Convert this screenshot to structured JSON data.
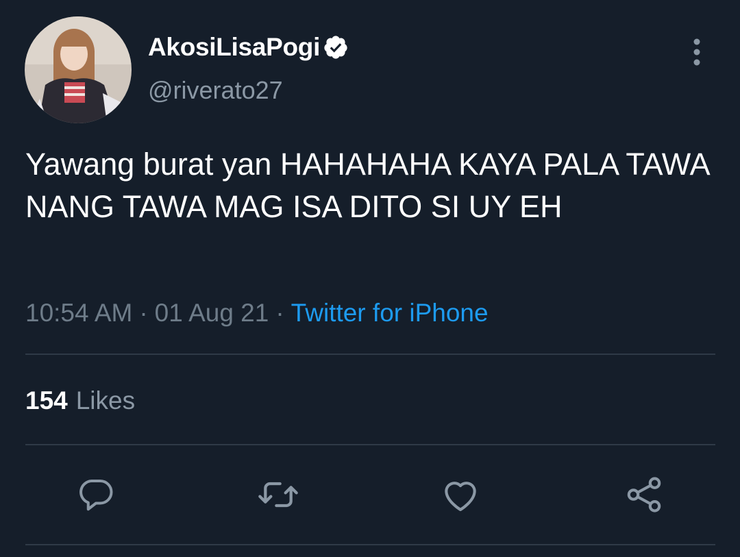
{
  "tweet": {
    "display_name": "AkosiLisaPogi",
    "handle": "@riverato27",
    "verified": true,
    "text": "Yawang burat yan HAHAHAHA KAYA PALA TAWA NANG TAWA MAG ISA DITO SI UY EH",
    "time": "10:54 AM",
    "separator": "·",
    "date": "01 Aug 21",
    "source": "Twitter for iPhone",
    "likes_count": "154",
    "likes_label": "Likes"
  },
  "icons": {
    "avatar": "profile-photo",
    "verified": "verified-badge-icon",
    "more": "more-vertical-icon",
    "reply": "reply-icon",
    "retweet": "retweet-icon",
    "like": "heart-icon",
    "share": "share-icon"
  },
  "colors": {
    "background": "#151e2a",
    "primary_text": "#ffffff",
    "secondary_text": "#8b98a5",
    "accent": "#1d9bf0",
    "divider": "#2f3a47",
    "icon": "#8b98a5"
  }
}
